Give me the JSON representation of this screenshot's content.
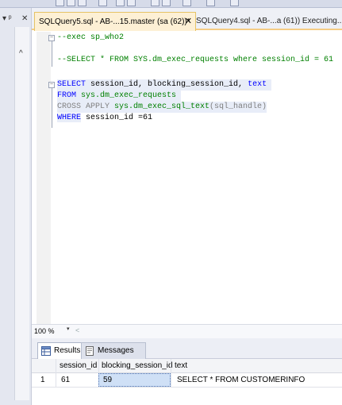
{
  "toolbar": {
    "icons": [
      "toolbar-button-icon"
    ]
  },
  "left_panel": {
    "pin_label": "▾ ᵖ",
    "close_label": "✕",
    "scroll_up": "^"
  },
  "tabs": [
    {
      "label": "SQLQuery5.sql - AB-...15.master (sa (62))*",
      "close": "✕"
    },
    {
      "label": "SQLQuery4.sql - AB-...a (61)) Executing...*"
    }
  ],
  "editor": {
    "lines": {
      "l1_prefix": "--exec ",
      "l1_name": "sp_who2",
      "l2": "--SELECT * FROM SYS.dm_exec_requests where session_id = 61",
      "l3_kw": "SELECT",
      "l3_rest": " session_id, blocking_session_id, ",
      "l3_text": "text",
      "l4_kw": "FROM",
      "l4_obj": " sys.dm_exec_requests",
      "l5_kw": "CROSS APPLY",
      "l5_obj": " sys.dm_exec_sql_text",
      "l5_arg": "(sql_handle)",
      "l6_kw": "WHERE",
      "l6_rest": " session_id =61"
    }
  },
  "zoom": {
    "value": "100 %",
    "dropdown": "▾",
    "scroll_left": "<"
  },
  "results_tabs": {
    "results": "Results",
    "messages": "Messages"
  },
  "grid": {
    "columns": [
      "session_id",
      "blocking_session_id",
      "text"
    ],
    "rows": [
      {
        "row_num": "1",
        "session_id": "61",
        "blocking_session_id": "59",
        "text": "SELECT * FROM CUSTOMERINFO"
      }
    ]
  }
}
